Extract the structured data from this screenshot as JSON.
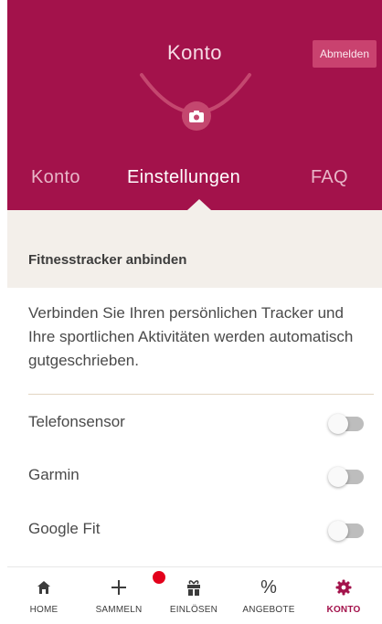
{
  "header": {
    "title": "Konto",
    "logout_label": "Abmelden",
    "camera_icon": "camera-icon"
  },
  "tabs": [
    {
      "label": "Konto",
      "active": false
    },
    {
      "label": "Einstellungen",
      "active": true
    },
    {
      "label": "FAQ",
      "active": false
    }
  ],
  "section": {
    "title": "Fitnesstracker anbinden",
    "description": "Verbinden Sie Ihren persönlichen Tracker und Ihre sportlichen Aktivitäten werden automatisch gutgeschrieben."
  },
  "trackers": [
    {
      "label": "Telefonsensor",
      "enabled": false
    },
    {
      "label": "Garmin",
      "enabled": false
    },
    {
      "label": "Google Fit",
      "enabled": false
    }
  ],
  "bottom_nav": [
    {
      "label": "HOME",
      "icon": "home-icon",
      "active": false
    },
    {
      "label": "SAMMELN",
      "icon": "plus-icon",
      "active": false,
      "badge": true
    },
    {
      "label": "EINLÖSEN",
      "icon": "gift-icon",
      "active": false
    },
    {
      "label": "ANGEBOTE",
      "icon": "percent-icon",
      "active": false
    },
    {
      "label": "KONTO",
      "icon": "gear-icon",
      "active": true
    }
  ],
  "colors": {
    "brand": "#a3124b",
    "section_bg": "#f3efea",
    "badge": "#e3001b"
  }
}
